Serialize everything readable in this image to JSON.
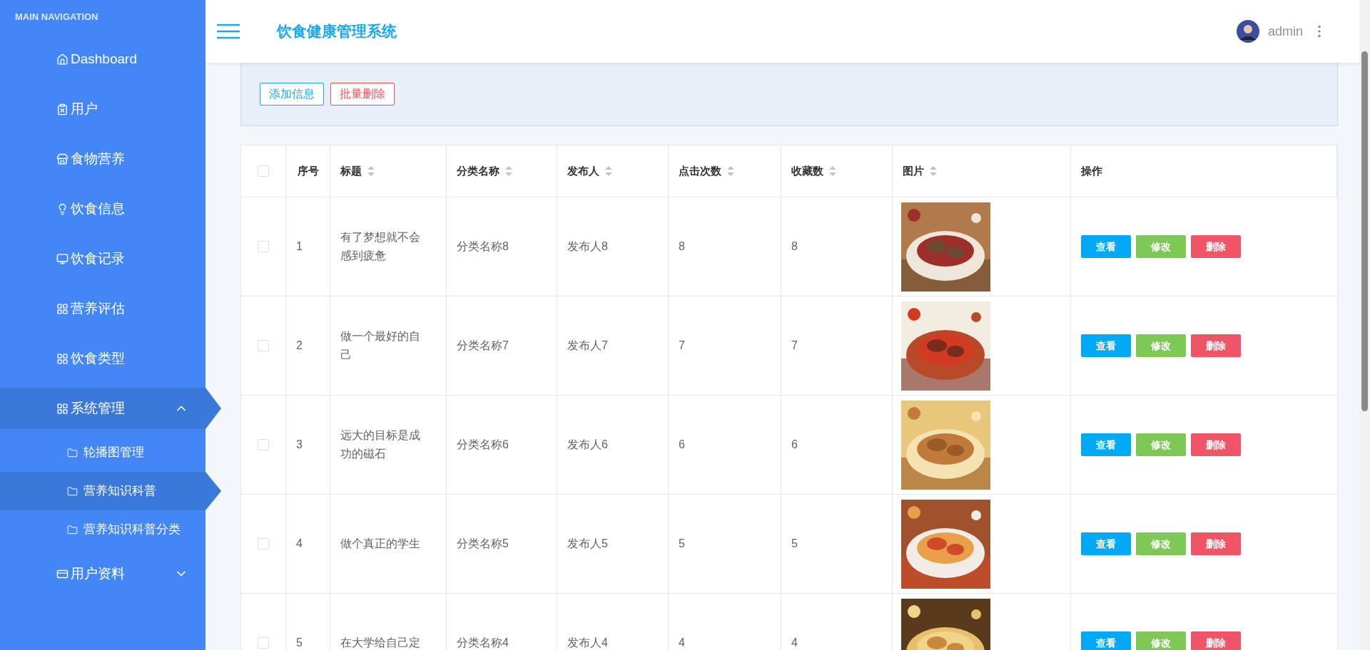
{
  "sidebar": {
    "heading": "MAIN NAVIGATION",
    "items": [
      {
        "label": "Dashboard",
        "kind": "link",
        "selected": false
      },
      {
        "label": "用户",
        "kind": "link",
        "selected": false
      },
      {
        "label": "食物营养",
        "kind": "link",
        "selected": false
      },
      {
        "label": "饮食信息",
        "kind": "link",
        "selected": false
      },
      {
        "label": "饮食记录",
        "kind": "link",
        "selected": false
      },
      {
        "label": "营养评估",
        "kind": "link",
        "selected": false
      },
      {
        "label": "饮食类型",
        "kind": "link",
        "selected": false
      },
      {
        "label": "系统管理",
        "kind": "group",
        "selected": true,
        "expanded": true,
        "children": [
          {
            "label": "轮播图管理",
            "selected": false
          },
          {
            "label": "营养知识科普",
            "selected": true
          },
          {
            "label": "营养知识科普分类",
            "selected": false
          }
        ]
      },
      {
        "label": "用户资料",
        "kind": "group",
        "selected": false,
        "expanded": false
      }
    ]
  },
  "header": {
    "title": "饮食健康管理系统",
    "user": "admin"
  },
  "toolbar": {
    "buttons": [
      {
        "label": "添加信息",
        "kind": "add"
      },
      {
        "label": "批量删除",
        "kind": "delete"
      }
    ]
  },
  "table": {
    "select_all": {
      "checked": false
    },
    "columns": [
      {
        "label": "序号",
        "sortable": false
      },
      {
        "label": "标题",
        "sortable": true
      },
      {
        "label": "分类名称",
        "sortable": true
      },
      {
        "label": "发布人",
        "sortable": true
      },
      {
        "label": "点击次数",
        "sortable": true
      },
      {
        "label": "收藏数",
        "sortable": true
      },
      {
        "label": "图片",
        "sortable": true
      },
      {
        "label": "操作",
        "sortable": false
      }
    ],
    "rows": [
      {
        "checked": false,
        "cells": [
          "1",
          "有了梦想就不会感到疲惫",
          "分类名称8",
          "发布人8",
          "8",
          "8"
        ],
        "actions": [
          "查看",
          "修改",
          "删除"
        ]
      },
      {
        "checked": false,
        "cells": [
          "2",
          "做一个最好的自己",
          "分类名称7",
          "发布人7",
          "7",
          "7"
        ],
        "actions": [
          "查看",
          "修改",
          "删除"
        ]
      },
      {
        "checked": false,
        "cells": [
          "3",
          "远大的目标是成功的磁石",
          "分类名称6",
          "发布人6",
          "6",
          "6"
        ],
        "actions": [
          "查看",
          "修改",
          "删除"
        ]
      },
      {
        "checked": false,
        "cells": [
          "4",
          "做个真正的学生",
          "分类名称5",
          "发布人5",
          "5",
          "5"
        ],
        "actions": [
          "查看",
          "修改",
          "删除"
        ]
      },
      {
        "checked": false,
        "cells": [
          "5",
          "在大学给自己定",
          "分类名称4",
          "发布人4",
          "4",
          "4"
        ],
        "actions": [
          "查看",
          "修改",
          "删除"
        ]
      }
    ]
  }
}
